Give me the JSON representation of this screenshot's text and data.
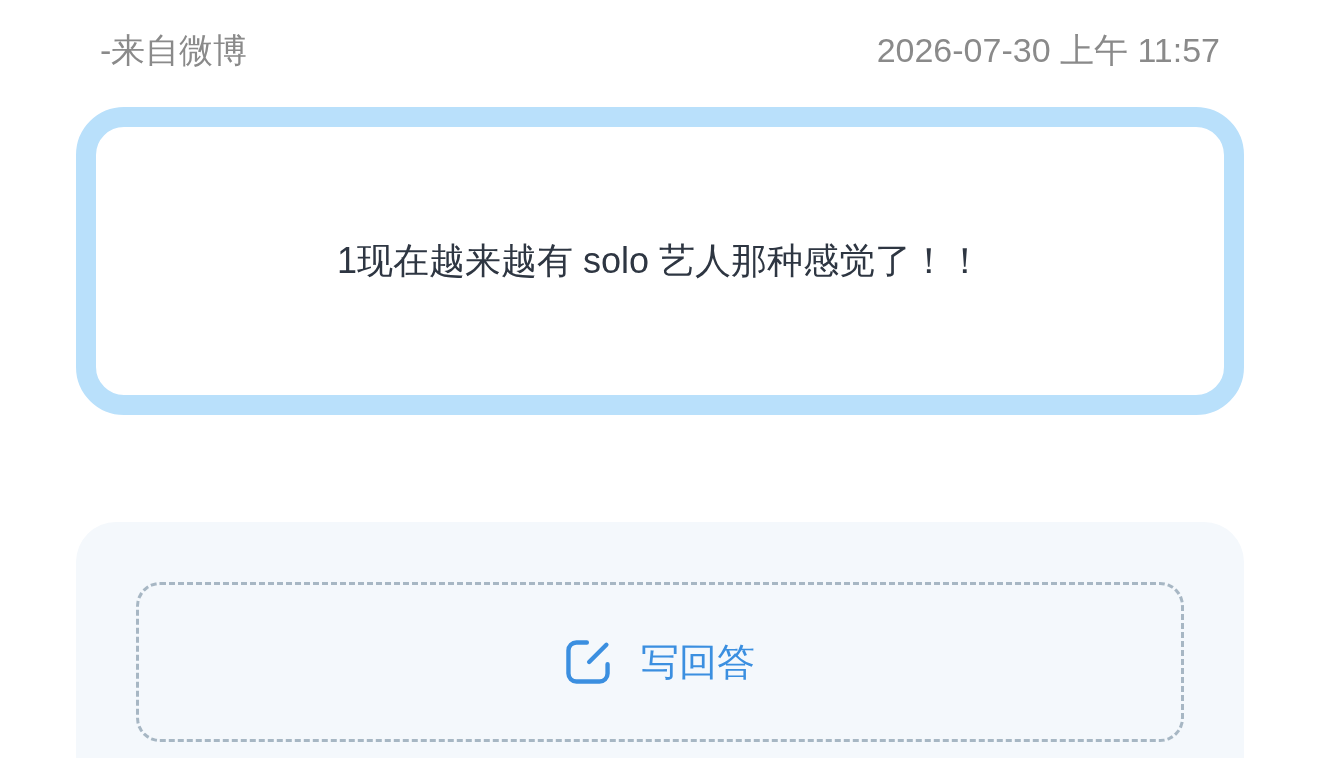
{
  "header": {
    "source": "-来自微博",
    "timestamp": "2026-07-30 上午 11:57"
  },
  "question": {
    "text": "1现在越来越有 solo 艺人那种感觉了！！"
  },
  "answer_action": {
    "label": "写回答"
  }
}
